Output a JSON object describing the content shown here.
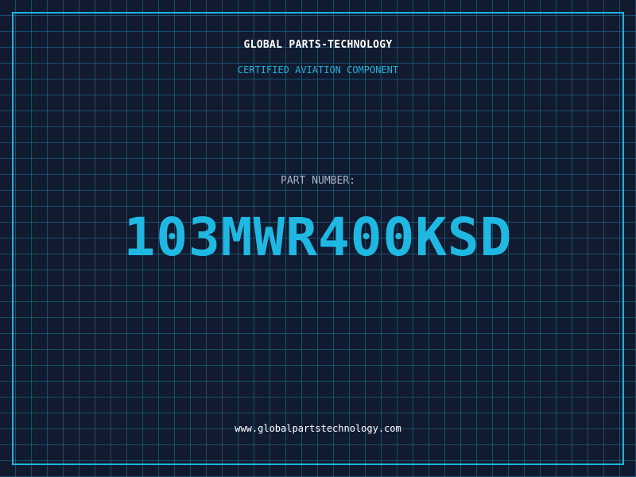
{
  "header": {
    "company": "GLOBAL PARTS-TECHNOLOGY",
    "subtitle": "CERTIFIED AVIATION COMPONENT"
  },
  "part": {
    "label": "PART NUMBER:",
    "number": "103MWR400KSD"
  },
  "footer": {
    "website": "www.globalpartstechnology.com"
  },
  "colors": {
    "background": "#111a2e",
    "grid": "#1e78a0",
    "accent": "#1fb5e0",
    "label": "#a8b3c4",
    "text": "#ffffff"
  }
}
